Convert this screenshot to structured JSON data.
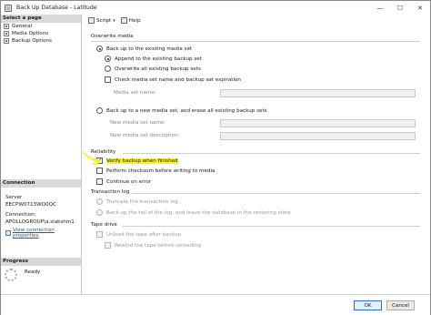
{
  "window": {
    "title": "Back Up Database - Latitude",
    "controls": {
      "minimize": "—",
      "maximize": "☐",
      "close": "✕"
    }
  },
  "left_panel": {
    "select_page_label": "Select a page",
    "pages": [
      {
        "label": "General",
        "icon": "page-icon"
      },
      {
        "label": "Media Options",
        "icon": "page-icon"
      },
      {
        "label": "Backup Options",
        "icon": "page-icon"
      }
    ],
    "connection": {
      "header": "Connection",
      "server_label": "Server",
      "server_value": "EECPW0713WQ0QC",
      "connection_label": "Connection:",
      "connection_value": "APOLLOGROUP\\a.slakshm1",
      "view_link": "View connection properties"
    },
    "progress": {
      "header": "Progress",
      "status": "Ready"
    }
  },
  "toolbar": {
    "script_label": "Script",
    "help_label": "Help"
  },
  "overwrite_media": {
    "title": "Overwrite media",
    "existing_set": "Back up to the existing media set",
    "append": "Append to the existing backup set",
    "overwrite_all": "Overwrite all existing backup sets",
    "check_media": "Check media set name and backup set expiration",
    "media_set_name_label": "Media set name:",
    "media_set_name_value": "",
    "new_set": "Back up to a new media set, and erase all existing backup sets",
    "new_media_set_name_label": "New media set name:",
    "new_media_set_name_value": "",
    "new_media_set_desc_label": "New media set description:",
    "new_media_set_desc_value": ""
  },
  "reliability": {
    "title": "Reliability",
    "verify": "Verify backup when finished",
    "checksum": "Perform checksum before writing to media",
    "continue_on_error": "Continue on error"
  },
  "transaction_log": {
    "title": "Transaction log",
    "truncate": "Truncate the transaction log",
    "tail": "Back up the tail of the log, and leave the database in the restoring state"
  },
  "tape_drive": {
    "title": "Tape drive",
    "unload": "Unload the tape after backup",
    "rewind": "Rewind the tape before unloading"
  },
  "buttons": {
    "ok": "OK",
    "cancel": "Cancel"
  },
  "colors": {
    "highlight": "#f6f233",
    "section_header": "#d9d9d9",
    "link": "#1e5aa8"
  },
  "state": {
    "existing_set_selected": true,
    "append_selected": true,
    "verify_checked": true
  }
}
